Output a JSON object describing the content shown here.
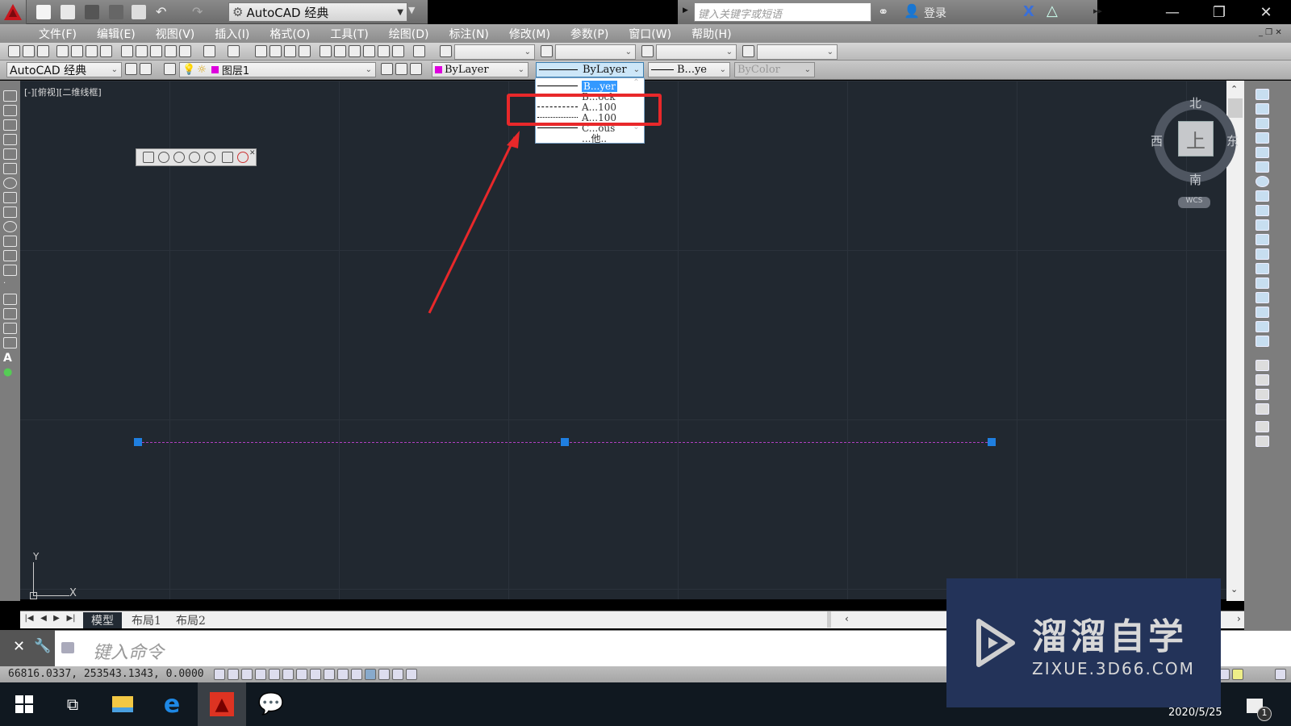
{
  "title_bar": {
    "workspace": "AutoCAD 经典",
    "search_placeholder": "键入关键字或短语",
    "login": "登录"
  },
  "menu": [
    "文件(F)",
    "编辑(E)",
    "视图(V)",
    "插入(I)",
    "格式(O)",
    "工具(T)",
    "绘图(D)",
    "标注(N)",
    "修改(M)",
    "参数(P)",
    "窗口(W)",
    "帮助(H)"
  ],
  "toolbar2": {
    "workspace_combo": "AutoCAD 经典",
    "layer_combo": "图层1",
    "color_combo": "ByLayer",
    "linetype_combo": "ByLayer",
    "lineweight_combo": "B...ye",
    "plotstyle_combo": "ByColor"
  },
  "linetype_dropdown": {
    "items": [
      {
        "label": "B...yer",
        "style": "solid",
        "selected": true
      },
      {
        "label": "B...ock",
        "style": "solid"
      },
      {
        "label": "A...100",
        "style": "dashed"
      },
      {
        "label": "A...100",
        "style": "dashdot"
      },
      {
        "label": "C...ous",
        "style": "solid"
      },
      {
        "label": "...他..",
        "style": "none"
      }
    ]
  },
  "viewport": {
    "label": "[-][俯视][二维线框]",
    "compass": {
      "north": "北",
      "south": "南",
      "east": "东",
      "west": "西",
      "top": "上",
      "wcs": "WCS"
    },
    "ucs": {
      "x": "X",
      "y": "Y"
    }
  },
  "layout_tabs": [
    {
      "label": "模型",
      "active": true
    },
    {
      "label": "布局1"
    },
    {
      "label": "布局2"
    }
  ],
  "command": {
    "placeholder": "键入命令"
  },
  "status": {
    "coordinates": "66816.0337, 253543.1343, 0.0000"
  },
  "taskbar": {
    "date": "2020/5/25",
    "notification_count": "1"
  },
  "watermark": {
    "title": "溜溜自学",
    "subtitle": "ZIXUE.3D66.COM"
  },
  "colors": {
    "annotation_red": "#e8282a",
    "line_color": "#b040c0",
    "grip_blue": "#1f7fe0"
  }
}
